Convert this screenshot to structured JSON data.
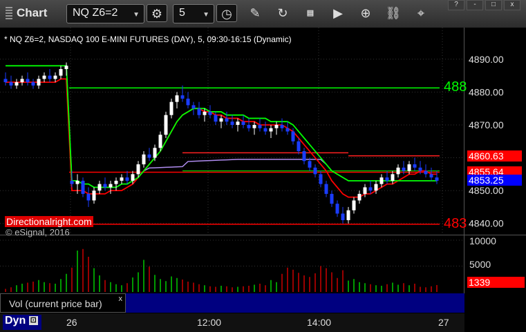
{
  "toolbar": {
    "app_title": "Chart",
    "symbol": "NQ Z6=2",
    "interval": "5"
  },
  "window_buttons": [
    "?",
    "-",
    "□",
    "x"
  ],
  "chart_data": {
    "type": "candlestick",
    "title": "* NQ Z6=2, NASDAQ 100 E-MINI FUTURES (DAY), 5, 09:30-16:15 (Dynamic)",
    "watermark": "© eSignal, 2016",
    "x_ticks": [
      "26",
      "12:00",
      "14:00",
      "27"
    ],
    "y_ticks": [
      "4890.00",
      "4880.00",
      "4870.00",
      "4860.00",
      "4850.00",
      "4840.00"
    ],
    "ylim": [
      4837,
      4895
    ],
    "candles": [
      [
        4884,
        4886,
        4882,
        4883
      ],
      [
        4883,
        4885,
        4881,
        4882
      ],
      [
        4882,
        4884,
        4881,
        4883
      ],
      [
        4883,
        4885,
        4882,
        4884
      ],
      [
        4884,
        4886,
        4882,
        4883
      ],
      [
        4883,
        4884,
        4881,
        4882
      ],
      [
        4882,
        4885,
        4881,
        4884
      ],
      [
        4884,
        4886,
        4883,
        4885
      ],
      [
        4885,
        4887,
        4883,
        4884
      ],
      [
        4884,
        4886,
        4883,
        4885
      ],
      [
        4885,
        4888,
        4884,
        4887
      ],
      [
        4887,
        4889,
        4885,
        4888
      ],
      [
        4853,
        4856,
        4851,
        4852
      ],
      [
        4852,
        4855,
        4849,
        4853
      ],
      [
        4853,
        4854,
        4848,
        4849
      ],
      [
        4849,
        4851,
        4845,
        4847
      ],
      [
        4847,
        4851,
        4846,
        4850
      ],
      [
        4850,
        4853,
        4849,
        4852
      ],
      [
        4852,
        4854,
        4850,
        4851
      ],
      [
        4851,
        4853,
        4849,
        4852
      ],
      [
        4852,
        4854,
        4850,
        4853
      ],
      [
        4853,
        4855,
        4852,
        4854
      ],
      [
        4854,
        4856,
        4852,
        4853
      ],
      [
        4853,
        4856,
        4852,
        4855
      ],
      [
        4855,
        4859,
        4854,
        4858
      ],
      [
        4858,
        4862,
        4857,
        4861
      ],
      [
        4861,
        4863,
        4859,
        4860
      ],
      [
        4860,
        4864,
        4859,
        4863
      ],
      [
        4863,
        4868,
        4862,
        4867
      ],
      [
        4867,
        4874,
        4866,
        4873
      ],
      [
        4873,
        4878,
        4872,
        4877
      ],
      [
        4877,
        4880,
        4875,
        4879
      ],
      [
        4879,
        4882,
        4877,
        4878
      ],
      [
        4878,
        4880,
        4875,
        4876
      ],
      [
        4876,
        4877,
        4873,
        4875
      ],
      [
        4875,
        4877,
        4872,
        4873
      ],
      [
        4873,
        4875,
        4871,
        4874
      ],
      [
        4874,
        4876,
        4872,
        4873
      ],
      [
        4873,
        4874,
        4870,
        4871
      ],
      [
        4871,
        4873,
        4869,
        4872
      ],
      [
        4872,
        4874,
        4870,
        4871
      ],
      [
        4871,
        4873,
        4869,
        4870
      ],
      [
        4870,
        4872,
        4868,
        4871
      ],
      [
        4871,
        4873,
        4869,
        4870
      ],
      [
        4870,
        4872,
        4868,
        4869
      ],
      [
        4869,
        4871,
        4867,
        4870
      ],
      [
        4870,
        4872,
        4868,
        4869
      ],
      [
        4869,
        4871,
        4867,
        4868
      ],
      [
        4868,
        4870,
        4866,
        4869
      ],
      [
        4869,
        4871,
        4867,
        4870
      ],
      [
        4870,
        4872,
        4868,
        4869
      ],
      [
        4869,
        4871,
        4867,
        4868
      ],
      [
        4868,
        4869,
        4864,
        4865
      ],
      [
        4865,
        4866,
        4861,
        4862
      ],
      [
        4862,
        4863,
        4858,
        4859
      ],
      [
        4859,
        4860,
        4856,
        4857
      ],
      [
        4857,
        4858,
        4854,
        4855
      ],
      [
        4855,
        4856,
        4851,
        4852
      ],
      [
        4852,
        4853,
        4848,
        4849
      ],
      [
        4849,
        4850,
        4845,
        4846
      ],
      [
        4846,
        4847,
        4842,
        4843
      ],
      [
        4843,
        4845,
        4840,
        4841
      ],
      [
        4841,
        4845,
        4840,
        4844
      ],
      [
        4844,
        4848,
        4843,
        4847
      ],
      [
        4847,
        4850,
        4846,
        4849
      ],
      [
        4849,
        4852,
        4848,
        4851
      ],
      [
        4851,
        4853,
        4849,
        4850
      ],
      [
        4850,
        4853,
        4849,
        4852
      ],
      [
        4852,
        4855,
        4851,
        4854
      ],
      [
        4854,
        4856,
        4852,
        4853
      ],
      [
        4853,
        4856,
        4852,
        4855
      ],
      [
        4855,
        4858,
        4854,
        4857
      ],
      [
        4857,
        4859,
        4855,
        4856
      ],
      [
        4856,
        4859,
        4855,
        4858
      ],
      [
        4858,
        4860,
        4856,
        4857
      ],
      [
        4857,
        4859,
        4855,
        4856
      ],
      [
        4856,
        4858,
        4854,
        4855
      ],
      [
        4855,
        4857,
        4853,
        4854
      ],
      [
        4854,
        4856,
        4852,
        4853
      ]
    ],
    "session_break_index": 12,
    "fast_ma": [
      4883,
      4883,
      4883,
      4883,
      4883,
      4883,
      4883,
      4883,
      4883,
      4883,
      4884,
      4884,
      4850,
      4850,
      4850,
      4849,
      4849,
      4849,
      4849,
      4850,
      4850,
      4850,
      4851,
      4852,
      4854,
      4856,
      4858,
      4860,
      4862,
      4865,
      4868,
      4871,
      4873,
      4874,
      4875,
      4875,
      4874,
      4874,
      4873,
      4873,
      4872,
      4872,
      4872,
      4871,
      4871,
      4871,
      4870,
      4870,
      4870,
      4870,
      4870,
      4869,
      4868,
      4866,
      4864,
      4862,
      4860,
      4858,
      4856,
      4853,
      4851,
      4849,
      4848,
      4848,
      4848,
      4849,
      4849,
      4850,
      4851,
      4852,
      4852,
      4853,
      4854,
      4855,
      4855,
      4856,
      4856,
      4855,
      4855
    ],
    "slow_ma": [
      4888,
      4888,
      4888,
      4888,
      4888,
      4888,
      4888,
      4888,
      4888,
      4888,
      4888,
      4888,
      4853,
      4853,
      4852,
      4852,
      4851,
      4851,
      4851,
      4851,
      4851,
      4852,
      4852,
      4853,
      4854,
      4856,
      4858,
      4860,
      4862,
      4865,
      4868,
      4871,
      4873,
      4874,
      4875,
      4875,
      4875,
      4874,
      4874,
      4874,
      4873,
      4873,
      4873,
      4873,
      4872,
      4872,
      4872,
      4872,
      4871,
      4871,
      4871,
      4871,
      4870,
      4868,
      4866,
      4864,
      4862,
      4860,
      4858,
      4856,
      4855,
      4854,
      4853,
      4853,
      4853,
      4853,
      4853,
      4853,
      4853,
      4853,
      4853,
      4853,
      4853,
      4853,
      4853,
      4853,
      4853,
      4853,
      4853
    ],
    "levels": [
      {
        "value": 4881.25,
        "color": "#00ff00",
        "label": "488"
      },
      {
        "value": 4839.75,
        "color": "#ff0000",
        "label": "483"
      }
    ],
    "price_badges": [
      {
        "value": "4860.63",
        "bg": "#ff0000",
        "fg": "#ffffff"
      },
      {
        "value": "4855.64",
        "bg": "#ff0000",
        "fg": "#ffffff"
      },
      {
        "value": "4853.25",
        "bg": "#0000ff",
        "fg": "#ffffff"
      }
    ],
    "volume": {
      "label": "Vol (current price bar)",
      "ticks": [
        "10000",
        "5000"
      ],
      "current_value": "1339",
      "max": 10000,
      "bars": [
        600,
        900,
        1300,
        1600,
        1800,
        2000,
        2300,
        1900,
        1700,
        1600,
        2500,
        3500,
        4700,
        8000,
        8300,
        6800,
        4600,
        3200,
        2300,
        1900,
        1500,
        1300,
        1700,
        2800,
        3800,
        6200,
        4900,
        3300,
        2500,
        2100,
        3000,
        2700,
        2400,
        2000,
        1800,
        1500,
        1300,
        1100,
        1000,
        1200,
        1100,
        900,
        1000,
        1100,
        1200,
        1400,
        1600,
        1300,
        2300,
        1900,
        3500,
        4700,
        4300,
        3700,
        3200,
        2900,
        3600,
        5000,
        4600,
        3800,
        2700,
        4200,
        2200,
        2500,
        1900,
        1700,
        1500,
        1300,
        1200,
        1500,
        1800,
        1400,
        1700,
        1300,
        1600,
        1000,
        900,
        1100,
        1339
      ]
    }
  },
  "logo_text": "Directionalright.com",
  "bottom": {
    "dyn_label": "Dyn"
  },
  "colors": {
    "up": "#00ff00",
    "down": "#ff0000",
    "candle_up": "#ffffff",
    "candle_down": "#0000ff",
    "fast_ma": "#ff0000",
    "slow_ma": "#00ff00",
    "avg_line": "#b08cf0",
    "prev_line": "#ff0000"
  }
}
